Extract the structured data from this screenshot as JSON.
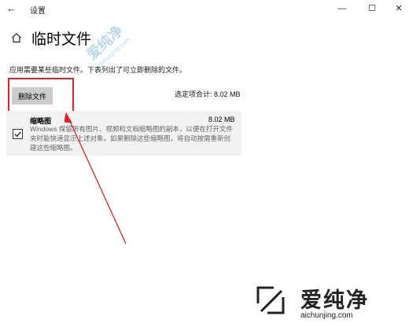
{
  "window": {
    "title": "设置",
    "back_glyph": "←",
    "min_glyph": "—",
    "max_glyph": "☐",
    "close_glyph": "✕"
  },
  "page": {
    "title": "临时文件",
    "description": "应用需要某些临时文件。下表列出了可立即删除的文件。"
  },
  "toolbar": {
    "delete_label": "删除文件",
    "total_label": "选定项合计: 8.02 MB"
  },
  "items": [
    {
      "name": "缩略图",
      "size": "8.02 MB",
      "checked": true,
      "description": "Windows 保留所有图片、视频和文档缩略图的副本，以便在打开文件夹时能快速显示上述对象。如果删除这些缩略图，将自动按需重新创建这些缩略图。"
    }
  ],
  "watermark": {
    "cn": "爱纯净",
    "en": "aichunjing.com"
  },
  "colors": {
    "highlight": "#e02222",
    "watermark_blue": "#6fa7d8"
  }
}
